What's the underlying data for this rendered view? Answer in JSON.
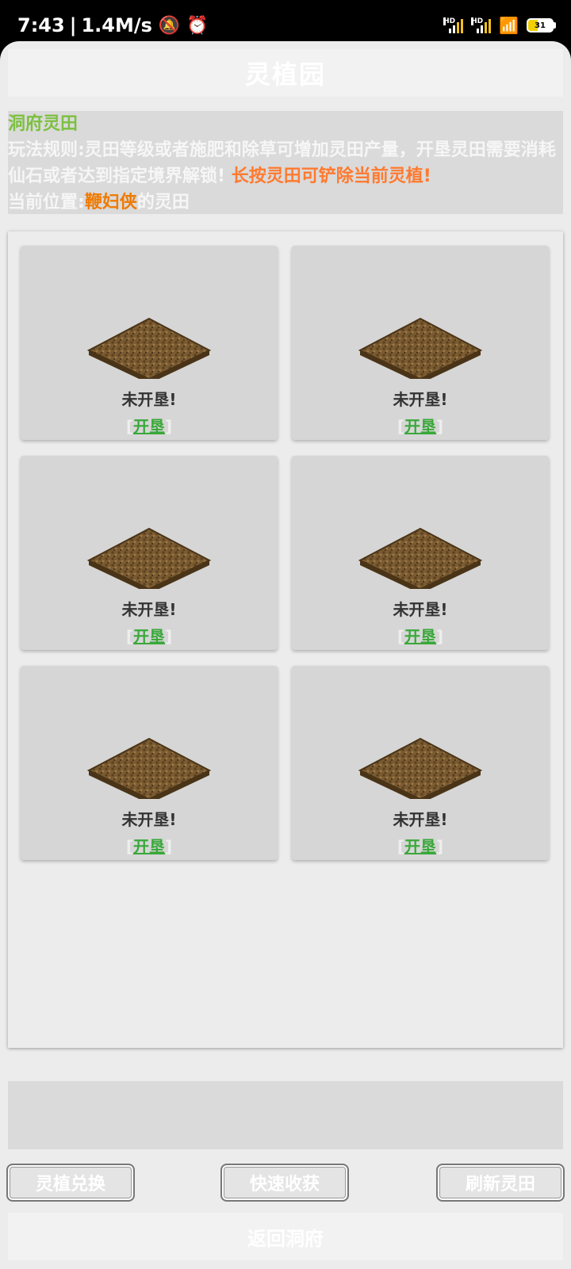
{
  "status_bar": {
    "time": "7:43",
    "separator": "|",
    "speed": "1.4M/s",
    "battery": "31"
  },
  "header": {
    "title": "灵植园"
  },
  "info": {
    "heading": "洞府灵田",
    "rules": "玩法规则:灵田等级或者施肥和除草可增加灵田产量，开垦灵田需要消耗仙石或者达到指定境界解锁!",
    "warning": " 长按灵田可铲除当前灵植!",
    "location_prefix": "当前位置:",
    "player_name": "鞭妇侠",
    "location_suffix": "的灵田"
  },
  "plots": [
    {
      "status": "未开垦!",
      "action": "开垦"
    },
    {
      "status": "未开垦!",
      "action": "开垦"
    },
    {
      "status": "未开垦!",
      "action": "开垦"
    },
    {
      "status": "未开垦!",
      "action": "开垦"
    },
    {
      "status": "未开垦!",
      "action": "开垦"
    },
    {
      "status": "未开垦!",
      "action": "开垦"
    }
  ],
  "buttons": {
    "exchange": "灵植兑换",
    "harvest": "快速收获",
    "refresh": "刷新灵田"
  },
  "footer": {
    "back": "返回洞府"
  },
  "colors": {
    "heading": "#7cc040",
    "warning": "#ff7a30",
    "player": "#f07a00",
    "action_link": "#3aa83a"
  }
}
